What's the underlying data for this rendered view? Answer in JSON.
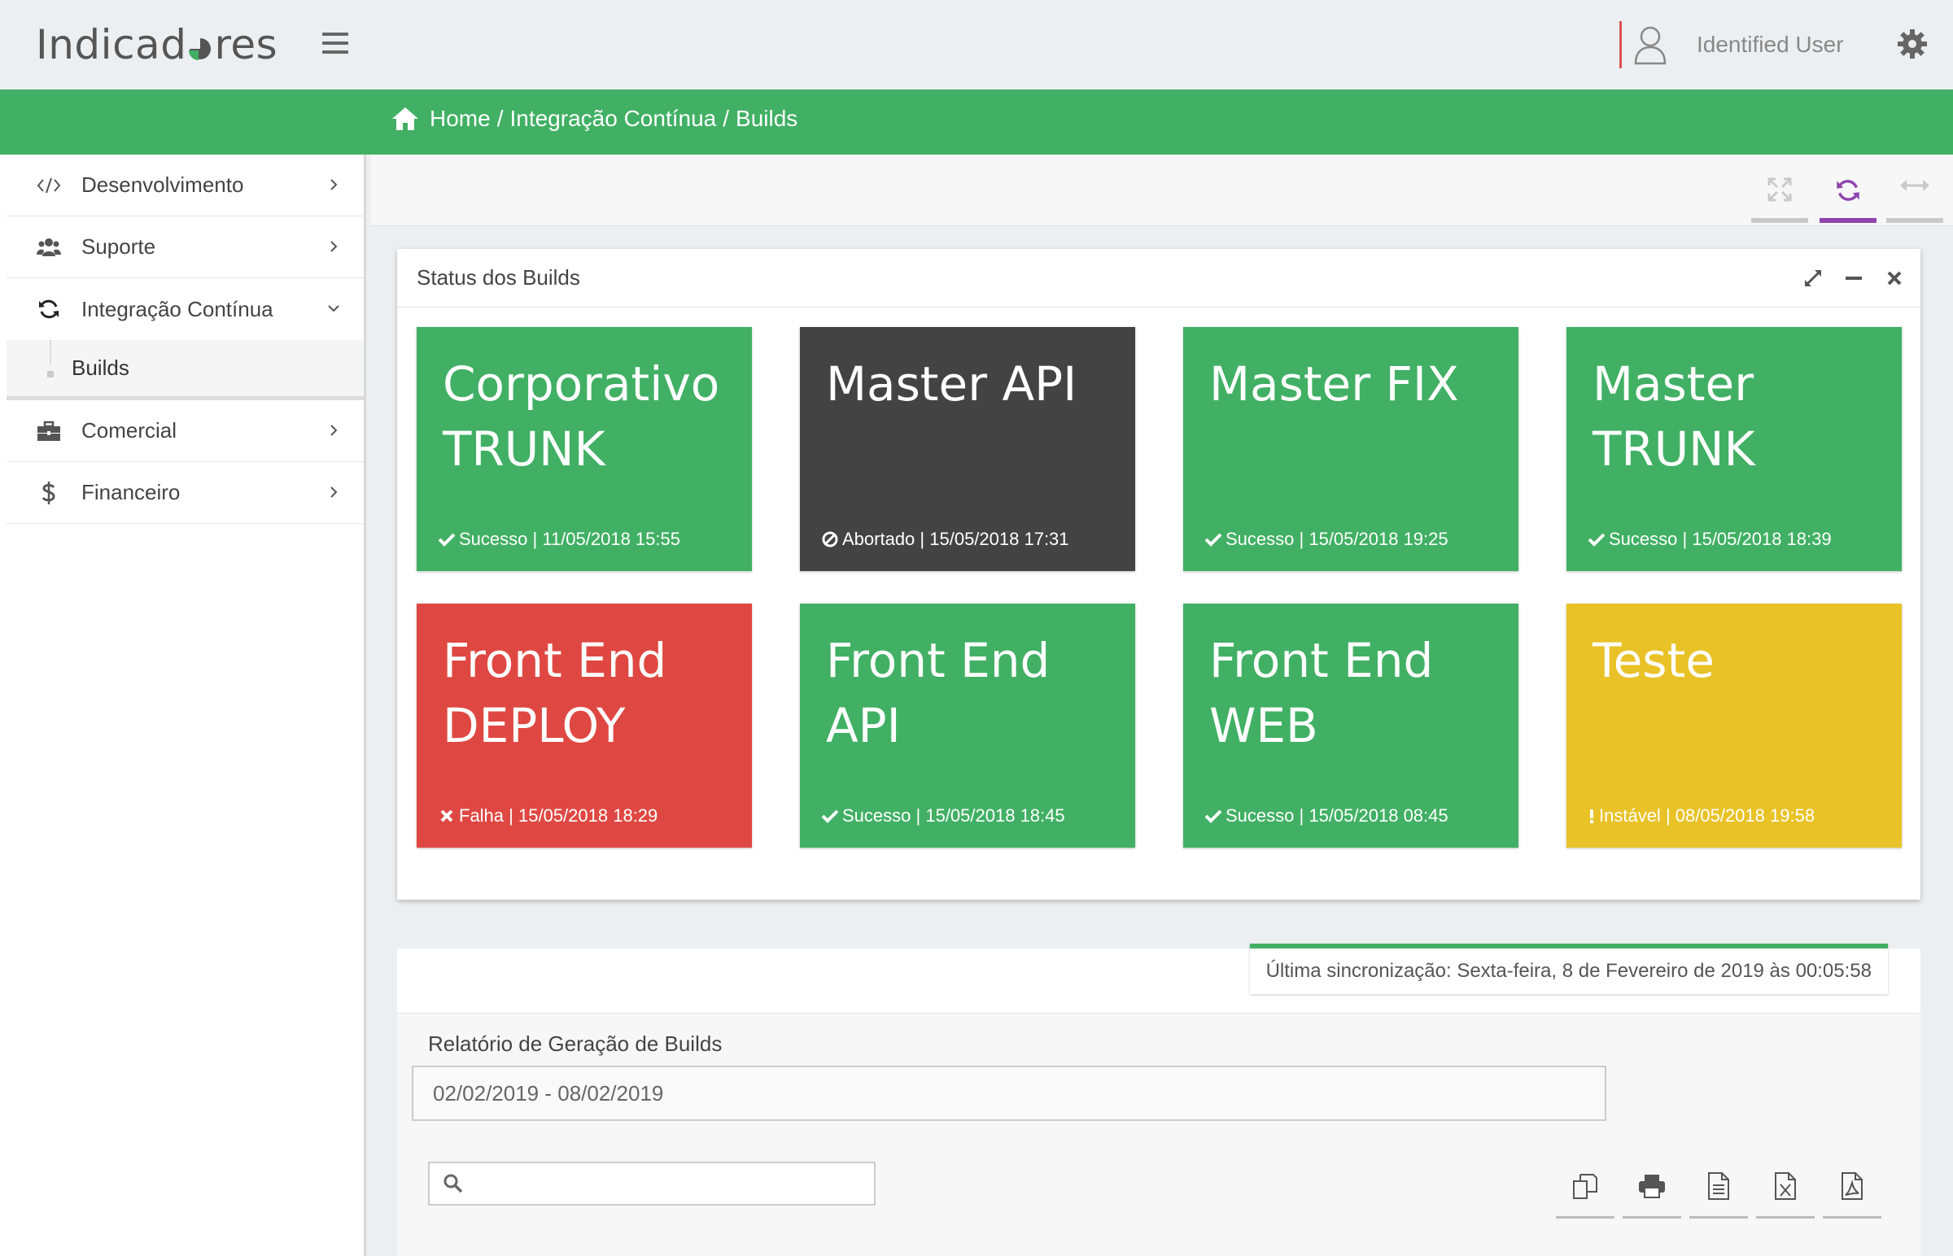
{
  "header": {
    "logo_text_start": "Indicad",
    "logo_text_end": "res",
    "user_name": "Identified User"
  },
  "breadcrumb": {
    "home": "Home",
    "level1": "Integração Contínua",
    "level2": "Builds",
    "separator": "/"
  },
  "sidebar": {
    "items": [
      {
        "label": "Desenvolvimento",
        "icon": "code-icon"
      },
      {
        "label": "Suporte",
        "icon": "users-icon"
      },
      {
        "label": "Integração Contínua",
        "icon": "refresh-icon"
      },
      {
        "label": "Comercial",
        "icon": "briefcase-icon"
      },
      {
        "label": "Financeiro",
        "icon": "dollar-icon"
      }
    ],
    "sub_item": "Builds"
  },
  "status_panel": {
    "title": "Status dos Builds"
  },
  "tiles": [
    {
      "name": "Corporativo\nTRUNK",
      "status": "Sucesso",
      "date": "11/05/2018 15:55",
      "color": "#41b064",
      "icon": "check-icon"
    },
    {
      "name": "Master API",
      "status": "Abortado",
      "date": "15/05/2018 17:31",
      "color": "#434343",
      "icon": "ban-icon"
    },
    {
      "name": "Master FIX",
      "status": "Sucesso",
      "date": "15/05/2018 19:25",
      "color": "#41b064",
      "icon": "check-icon"
    },
    {
      "name": "Master\nTRUNK",
      "status": "Sucesso",
      "date": "15/05/2018 18:39",
      "color": "#41b064",
      "icon": "check-icon"
    },
    {
      "name": "Front End\nDEPLOY",
      "status": "Falha",
      "date": "15/05/2018 18:29",
      "color": "#df4842",
      "icon": "times-icon"
    },
    {
      "name": "Front End\nAPI",
      "status": "Sucesso",
      "date": "15/05/2018 18:45",
      "color": "#41b064",
      "icon": "check-icon"
    },
    {
      "name": "Front End\nWEB",
      "status": "Sucesso",
      "date": "15/05/2018 08:45",
      "color": "#41b064",
      "icon": "check-icon"
    },
    {
      "name": "Teste",
      "status": "Instável",
      "date": "08/05/2018 19:58",
      "color": "#e9c227",
      "icon": "exclamation-icon"
    }
  ],
  "report": {
    "sync_text": "Última sincronização: Sexta-feira, 8 de Fevereiro de 2019 às 00:05:58",
    "title": "Relatório de Geração de Builds",
    "date_range": "02/02/2019 - 08/02/2019",
    "search_value": ""
  },
  "colors": {
    "accent_green": "#41b064",
    "active_purple": "#8e44ad",
    "danger_red": "#df4842",
    "warning_yellow": "#e9c227",
    "dark": "#434343"
  }
}
